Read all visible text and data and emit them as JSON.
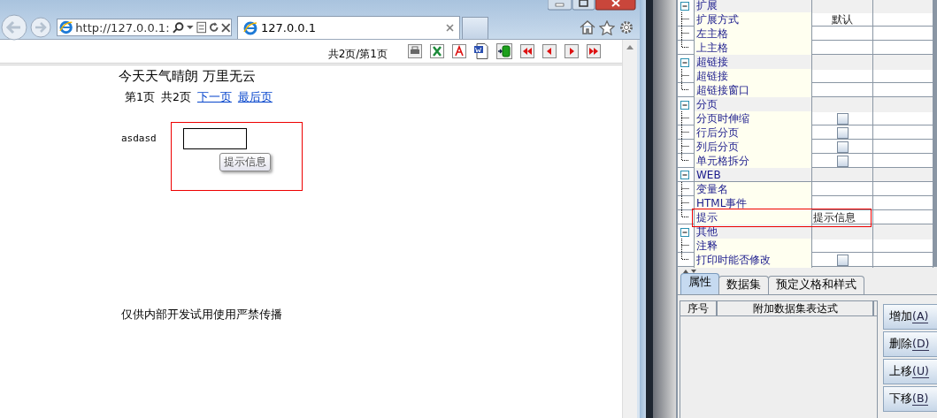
{
  "browser": {
    "address": "http://127.0.0.1:",
    "tabs": [
      {
        "label": "127.0.0.1",
        "selected": true
      }
    ],
    "report": {
      "page_info": "共2页/第1页",
      "title": "今天天气晴朗  万里无云",
      "pager": [
        {
          "kind": "text",
          "label": "第1页"
        },
        {
          "kind": "text",
          "label": "共2页"
        },
        {
          "kind": "link",
          "label": "下一页"
        },
        {
          "kind": "link",
          "label": "最后页"
        }
      ],
      "field_label": "asdasd",
      "tooltip": "提示信息",
      "footer": "仅供内部开发试用使用严禁传播"
    }
  },
  "properties": {
    "groups": [
      {
        "name": "扩展",
        "expanded": true,
        "children": [
          {
            "name": "扩展方式",
            "kind": "text",
            "value": "默认"
          },
          {
            "name": "左主格",
            "kind": "text"
          },
          {
            "name": "上主格",
            "kind": "text"
          }
        ]
      },
      {
        "name": "超链接",
        "expanded": true,
        "children": [
          {
            "name": "超链接",
            "kind": "text"
          },
          {
            "name": "超链接窗口",
            "kind": "text"
          }
        ]
      },
      {
        "name": "分页",
        "expanded": true,
        "children": [
          {
            "name": "分页时伸缩",
            "kind": "checkbox",
            "checked": false
          },
          {
            "name": "行后分页",
            "kind": "checkbox",
            "checked": false
          },
          {
            "name": "列后分页",
            "kind": "checkbox",
            "checked": false
          },
          {
            "name": "单元格拆分",
            "kind": "checkbox",
            "checked": false
          }
        ]
      },
      {
        "name": "WEB",
        "expanded": true,
        "children": [
          {
            "name": "变量名",
            "kind": "text"
          },
          {
            "name": "HTML事件",
            "kind": "text"
          },
          {
            "name": "提示",
            "kind": "text",
            "value": "提示信息",
            "highlighted": true
          }
        ]
      },
      {
        "name": "其他",
        "expanded": true,
        "children": [
          {
            "name": "注释",
            "kind": "text"
          },
          {
            "name": "打印时能否修改",
            "kind": "checkbox",
            "checked": false
          }
        ]
      }
    ]
  },
  "bottom_tabs": [
    {
      "label": "属性",
      "selected": true
    },
    {
      "label": "数据集",
      "selected": false
    },
    {
      "label": "预定义格和样式",
      "selected": false
    }
  ],
  "table": {
    "columns": [
      "序号",
      "附加数据集表达式"
    ]
  },
  "buttons": [
    {
      "label": "增加",
      "key": "(A)"
    },
    {
      "label": "删除",
      "key": "(D)"
    },
    {
      "label": "上移",
      "key": "(U)"
    },
    {
      "label": "下移",
      "key": "(B)"
    }
  ]
}
